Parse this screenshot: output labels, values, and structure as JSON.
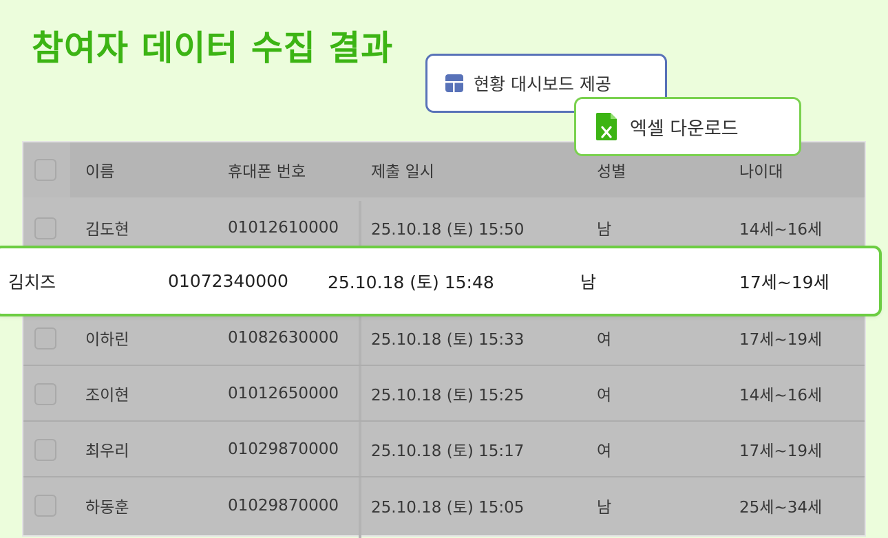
{
  "page": {
    "title": "참여자 데이터 수집 결과"
  },
  "popups": {
    "dashboard_label": "현황 대시보드 제공",
    "excel_label": "엑셀 다운로드",
    "dashboard_icon": "dashboard-layout-icon",
    "excel_icon": "excel-file-icon",
    "dashboard_color": "#5872b8",
    "excel_color": "#3cb414"
  },
  "table": {
    "headers": {
      "name": "이름",
      "phone": "휴대폰 번호",
      "submitted": "제출 일시",
      "gender": "성별",
      "age": "나이대"
    },
    "rows": [
      {
        "name": "김도현",
        "phone": "01012610000",
        "submitted": "25.10.18 (토) 15:50",
        "gender": "남",
        "age": "14세~16세"
      },
      {
        "name": "김치즈",
        "phone": "01072340000",
        "submitted": "25.10.18 (토) 15:48",
        "gender": "남",
        "age": "17세~19세"
      },
      {
        "name": "이하린",
        "phone": "01082630000",
        "submitted": "25.10.18 (토) 15:33",
        "gender": "여",
        "age": "17세~19세"
      },
      {
        "name": "조이현",
        "phone": "01012650000",
        "submitted": "25.10.18 (토) 15:25",
        "gender": "여",
        "age": "14세~16세"
      },
      {
        "name": "최우리",
        "phone": "01029870000",
        "submitted": "25.10.18 (토) 15:17",
        "gender": "여",
        "age": "17세~19세"
      },
      {
        "name": "하동훈",
        "phone": "01029870000",
        "submitted": "25.10.18 (토) 15:05",
        "gender": "남",
        "age": "25세~34세"
      }
    ]
  },
  "colors": {
    "title": "#3cb414",
    "highlight_border": "#6ccd42",
    "background": "#ecfddc"
  }
}
